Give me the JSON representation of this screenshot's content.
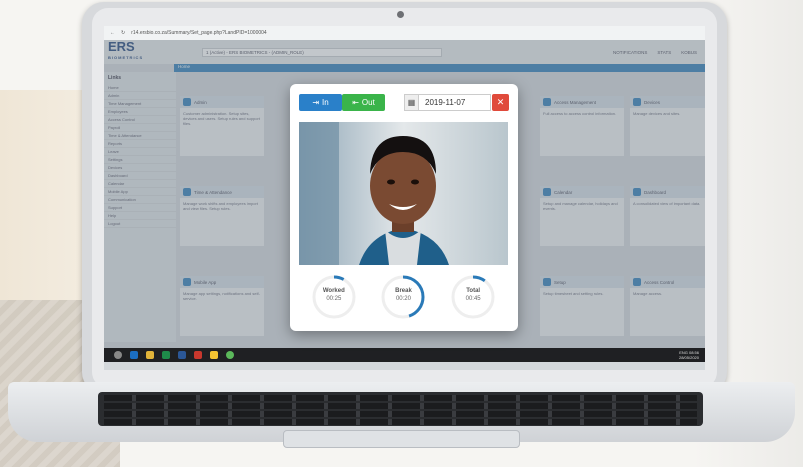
{
  "browser": {
    "url": "r14.ersbio.co.za/Summary/Set_page.php?LandPID=1000004"
  },
  "app": {
    "logo_main": "ERS",
    "logo_sub": "BIOMETRICS",
    "company": "1 (Active) - ERS BIOMETRICS - (ADMIN_ROLE)",
    "nav": [
      "NOTIFICATIONS",
      "STATS",
      "KOBUS"
    ],
    "home": "Home"
  },
  "sidebar": {
    "title": "Links",
    "items": [
      "Home",
      "Admin",
      "Time Management",
      "Employees",
      "Access Control",
      "Payroll",
      "Time & Attendance",
      "Reports",
      "Leave",
      "Settings",
      "Devices",
      "Dashboard",
      "Calendar",
      "Mobile App",
      "Communication",
      "Support",
      "Help",
      "Logout"
    ]
  },
  "tiles": [
    {
      "title": "Admin",
      "body": "Customer administration. Setup sites, devices and users. Setup rules and support files."
    },
    {
      "title": "Time & Attendance",
      "body": "Manage work shifts and employees import and view files. Setup rules."
    },
    {
      "title": "Mobile App",
      "body": "Manage app settings, notifications and self-service."
    },
    {
      "title": "Access Management",
      "body": "Full access to access control information."
    },
    {
      "title": "Calendar",
      "body": "Setup and manage calendar, holidays and events."
    },
    {
      "title": "Setup",
      "body": "Setup timesheet and setting rules."
    },
    {
      "title": "Devices",
      "body": "Manage devices and sites."
    },
    {
      "title": "Dashboard",
      "body": "A consolidated view of important data."
    },
    {
      "title": "Access Control",
      "body": "Manage access."
    }
  ],
  "taskbar": {
    "time": "08:56",
    "date": "28/05/2020",
    "lang": "ENG"
  },
  "modal": {
    "in_label": "In",
    "out_label": "Out",
    "date": "2019-11-07",
    "gauges": [
      {
        "label": "Worked",
        "value": "00:25",
        "progress": 0.08
      },
      {
        "label": "Break",
        "value": "00:20",
        "progress": 0.45
      },
      {
        "label": "Total",
        "value": "00:45",
        "progress": 0.1
      }
    ]
  },
  "colors": {
    "in": "#2a80c9",
    "out": "#3ab44a",
    "clear": "#e04a3b",
    "gauge": "#2a7ab8"
  }
}
